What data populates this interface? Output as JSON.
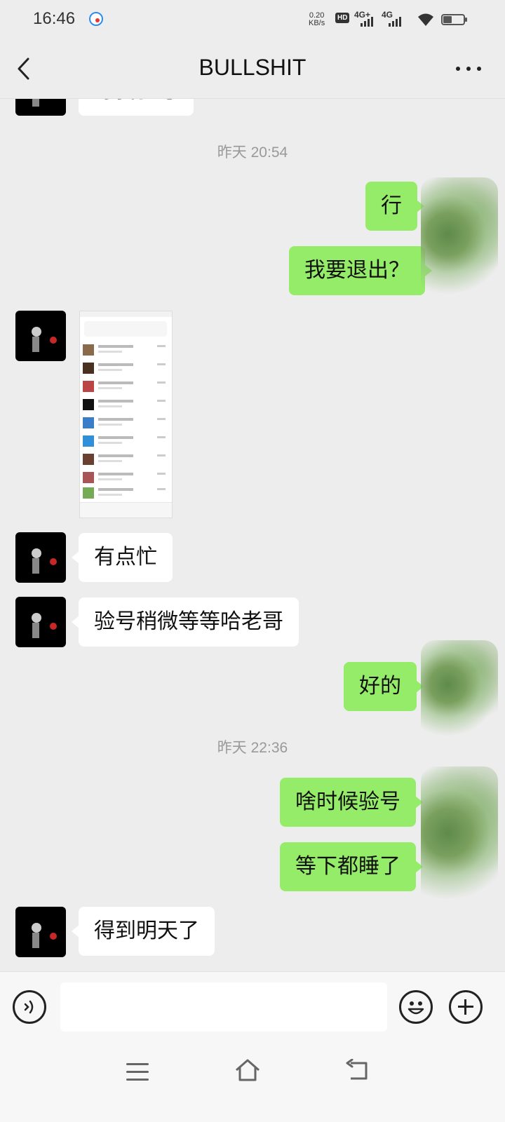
{
  "status_bar": {
    "time": "16:46",
    "speed_value": "0.20",
    "speed_unit": "KB/s",
    "hd_label": "HD",
    "sim1_label": "4G+",
    "sim2_label": "4G"
  },
  "header": {
    "title": "BULLSHIT"
  },
  "messages": [
    {
      "type": "in",
      "text": "等我验号",
      "partial": true
    },
    {
      "type": "timestamp",
      "text": "昨天 20:54"
    },
    {
      "type": "out",
      "text": "行"
    },
    {
      "type": "out",
      "text": "我要退出？"
    },
    {
      "type": "in_image",
      "text": ""
    },
    {
      "type": "in",
      "text": "有点忙"
    },
    {
      "type": "in",
      "text": "验号稍微等等哈老哥"
    },
    {
      "type": "out",
      "text": "好的"
    },
    {
      "type": "timestamp",
      "text": "昨天 22:36"
    },
    {
      "type": "out",
      "text": "啥时候验号"
    },
    {
      "type": "out",
      "text": "等下都睡了"
    },
    {
      "type": "in",
      "text": "得到明天了"
    }
  ],
  "input_bar": {
    "text_value": "",
    "icons": [
      "voice-icon",
      "emoji-icon",
      "plus-icon"
    ]
  },
  "nav_bar": {
    "icons": [
      "menu-icon",
      "home-icon",
      "back-icon"
    ]
  },
  "colors": {
    "outgoing_bubble": "#95ec69",
    "incoming_bubble": "#ffffff",
    "background": "#ededed"
  }
}
